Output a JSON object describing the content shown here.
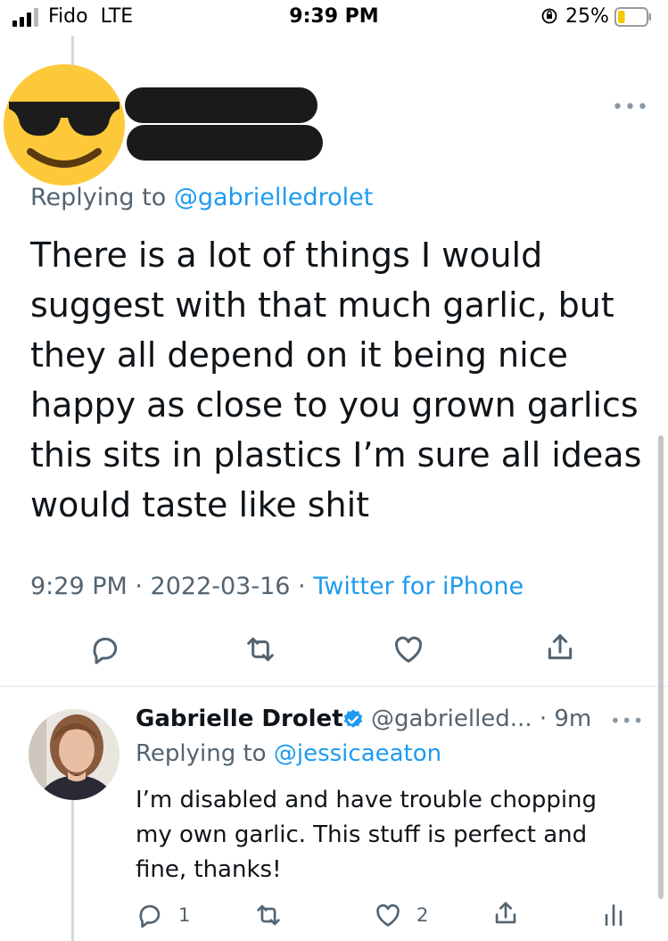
{
  "status_bar": {
    "carrier": "Fido",
    "network": "LTE",
    "time": "9:39 PM",
    "battery_percent": "25%",
    "battery_level": 0.25,
    "battery_color": "#f4c900"
  },
  "tweet": {
    "replying_label": "Replying to",
    "replying_handle": "@gabrielledrolet",
    "text_lines": [
      "There is a lot of things I would",
      "suggest with that much garlic, but",
      "they all depend on it being nice",
      "happy as close to you grown garlics",
      "this sits in plastics I’m sure all ideas",
      "would taste like shit"
    ],
    "time": "9:29 PM",
    "date": "2022-03-16",
    "source": "Twitter for iPhone",
    "separator": " · ",
    "actions": [
      "reply-icon",
      "retweet-icon",
      "like-icon",
      "share-icon"
    ]
  },
  "reply": {
    "name": "Gabrielle Drolet",
    "handle": "@gabrielled...",
    "age": "· 9m",
    "replying_label": "Replying to",
    "replying_handle": "@jessicaeaton",
    "text_lines": [
      "I’m disabled and have trouble chopping",
      "my own garlic. This stuff is perfect and",
      "fine, thanks!"
    ],
    "reply_count": "1",
    "like_count": "2"
  },
  "colors": {
    "accent": "#1d9bf0",
    "secondary_text": "#536471",
    "primary_text": "#0f1419"
  }
}
